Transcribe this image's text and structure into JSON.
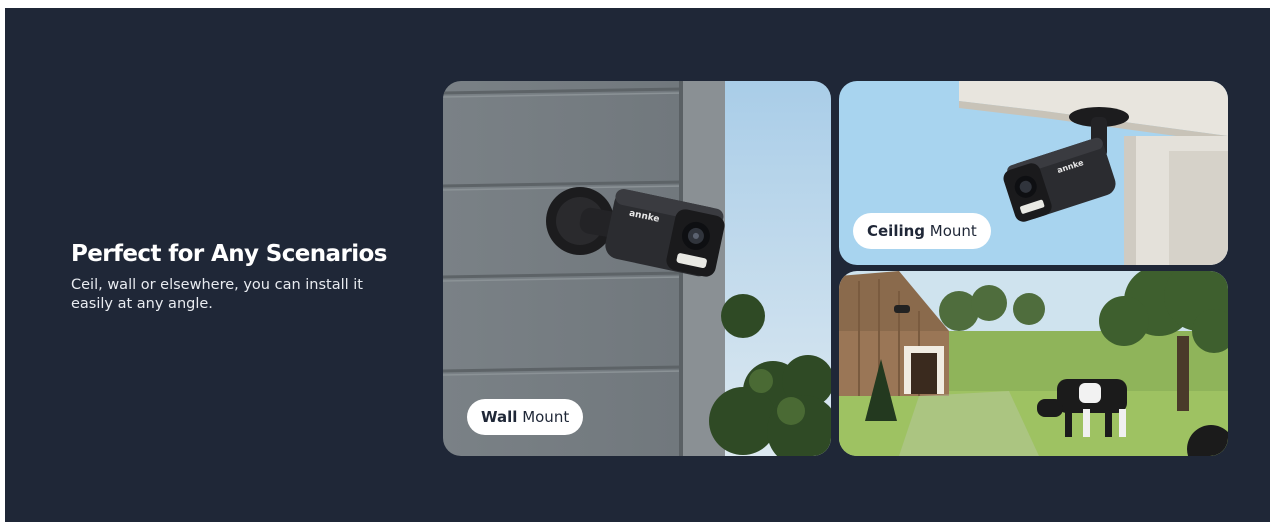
{
  "section": {
    "title": "Perfect for Any Scenarios",
    "description": "Ceil, wall or elsewhere, you can install it easily at any angle."
  },
  "tiles": [
    {
      "label_bold": "Wall",
      "label_rest": " Mount",
      "camera_brand": "annke"
    },
    {
      "label_bold": "Ceiling",
      "label_rest": " Mount",
      "camera_brand": "annke"
    },
    {
      "scene": "farm-barn-cow"
    }
  ],
  "colors": {
    "background": "#1f2737",
    "pill_bg": "#ffffff",
    "text": "#ffffff"
  }
}
